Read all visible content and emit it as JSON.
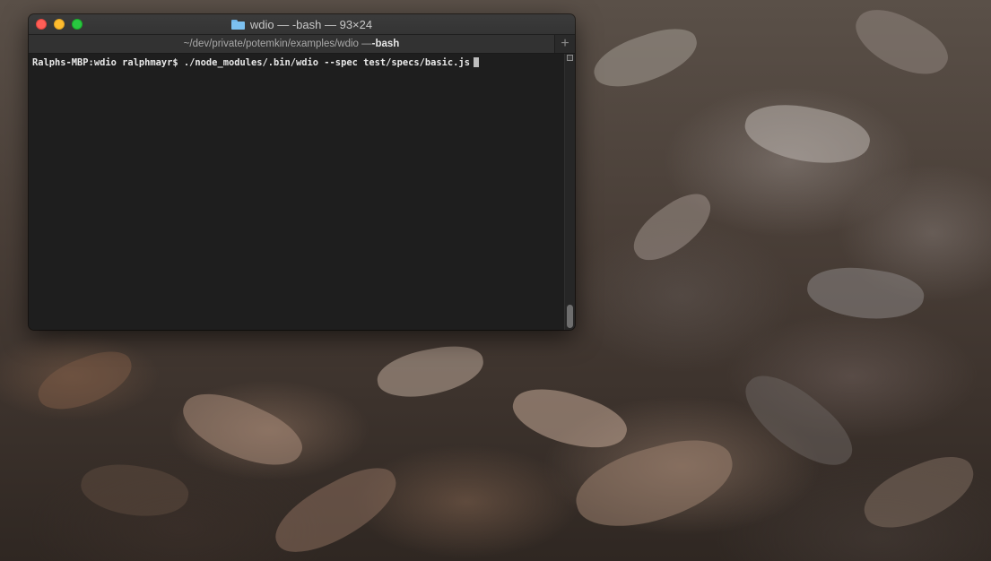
{
  "window": {
    "title": "wdio — -bash — 93×24",
    "title_icon": "folder-icon"
  },
  "tab": {
    "path": "~/dev/private/potemkin/examples/wdio — ",
    "process": "-bash",
    "new_tab_label": "+"
  },
  "terminal": {
    "prompt": "Ralphs-MBP:wdio ralphmayr$ ",
    "command": "./node_modules/.bin/wdio --spec test/specs/basic.js"
  },
  "colors": {
    "close": "#ff5f57",
    "minimize": "#febc2e",
    "zoom": "#28c840",
    "terminal_bg": "#1e1e1e",
    "terminal_text": "#e8e8e8"
  }
}
